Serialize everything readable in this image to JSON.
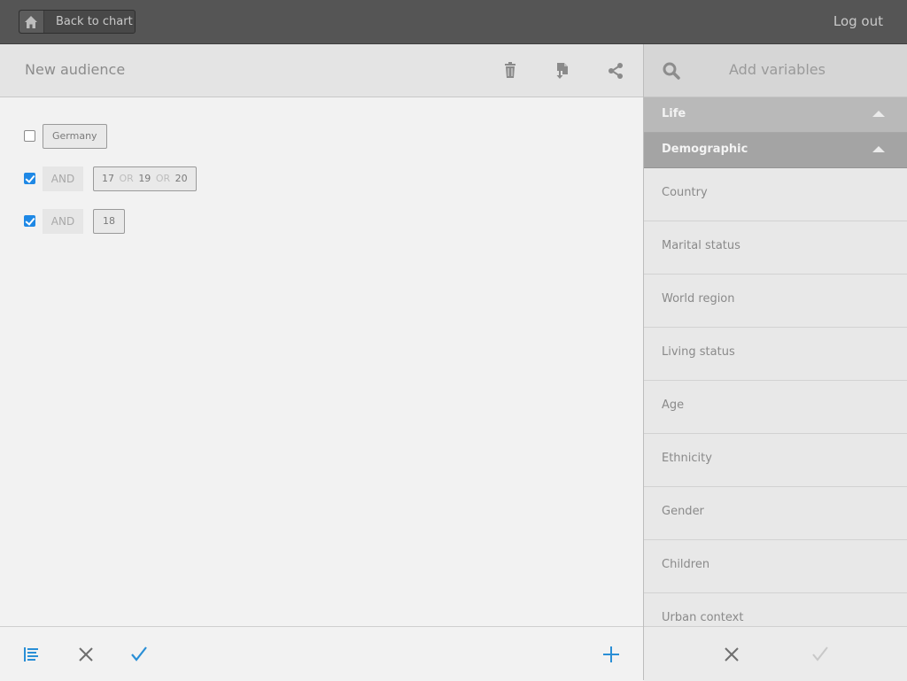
{
  "topbar": {
    "back_label": "Back to chart",
    "logout_label": "Log out"
  },
  "audience": {
    "title": "New audience",
    "rules": [
      {
        "checked": false,
        "values": [
          "Germany"
        ]
      },
      {
        "checked": true,
        "operator": "AND",
        "values": [
          "17",
          "19",
          "20"
        ],
        "joiner": "OR"
      },
      {
        "checked": true,
        "operator": "AND",
        "values": [
          "18"
        ]
      }
    ]
  },
  "variables": {
    "title": "Add variables",
    "categories": [
      {
        "label": "Life",
        "expanded": true
      },
      {
        "label": "Demographic",
        "expanded": true
      }
    ],
    "items": [
      "Country",
      "Marital status",
      "World region",
      "Living status",
      "Age",
      "Ethnicity",
      "Gender",
      "Children",
      "Urban context"
    ]
  },
  "colors": {
    "accent": "#2a8fd6",
    "topbar": "#555555"
  },
  "icons": {
    "header": [
      "trash-icon",
      "export-icon",
      "share-icon"
    ],
    "footer": [
      "list-icon",
      "close-icon",
      "check-icon",
      "add-icon"
    ]
  }
}
